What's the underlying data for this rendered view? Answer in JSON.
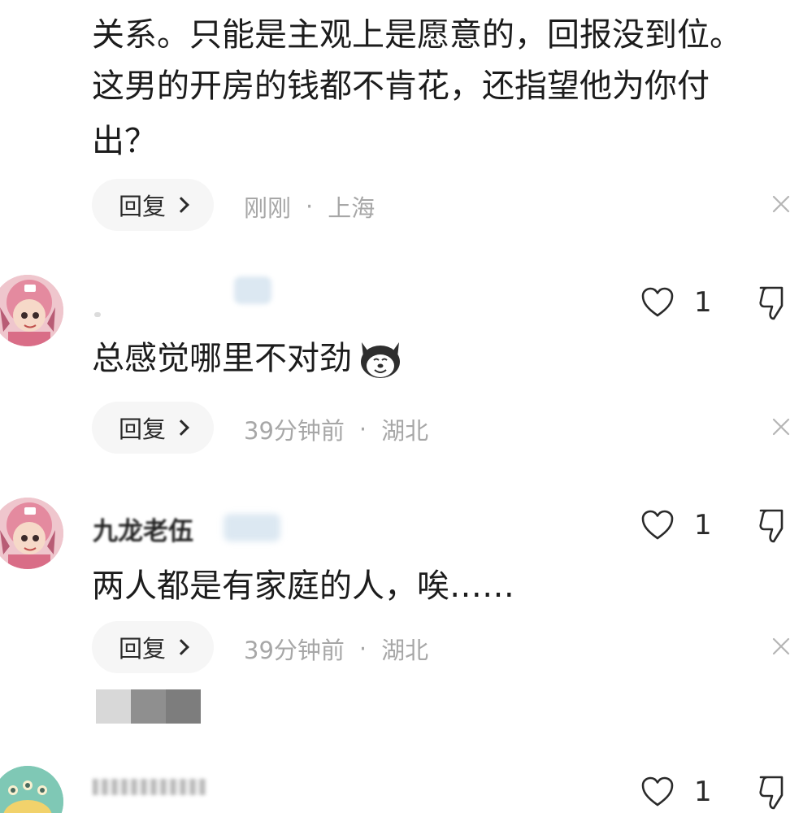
{
  "comments": [
    {
      "text_lines": [
        "关系。只能是主观上是愿意的，回报没到位。",
        "这男的开房的钱都不肯花，还指望他为你付",
        "出？"
      ],
      "reply_label": "回复",
      "time": "刚刚",
      "location": "上海"
    },
    {
      "username": "",
      "likes": "1",
      "text": "总感觉哪里不对劲",
      "emoji": "dog-emoji",
      "reply_label": "回复",
      "time": "39分钟前",
      "location": "湖北"
    },
    {
      "username": "九龙老伍",
      "likes": "1",
      "text": "两人都是有家庭的人，唉……",
      "reply_label": "回复",
      "time": "39分钟前",
      "location": "湖北"
    },
    {
      "username": "",
      "likes": "1"
    }
  ],
  "separator": "·",
  "colors": {
    "meta": "#a7a7a7",
    "reply_bg": "#f6f6f6",
    "text": "#1c1c1c",
    "avatar_pink": "#e8a6b3",
    "avatar_teal": "#7fc8b5"
  },
  "icons": [
    "heart-outline-icon",
    "thumbs-down-icon",
    "close-icon",
    "chevron-right-icon"
  ]
}
